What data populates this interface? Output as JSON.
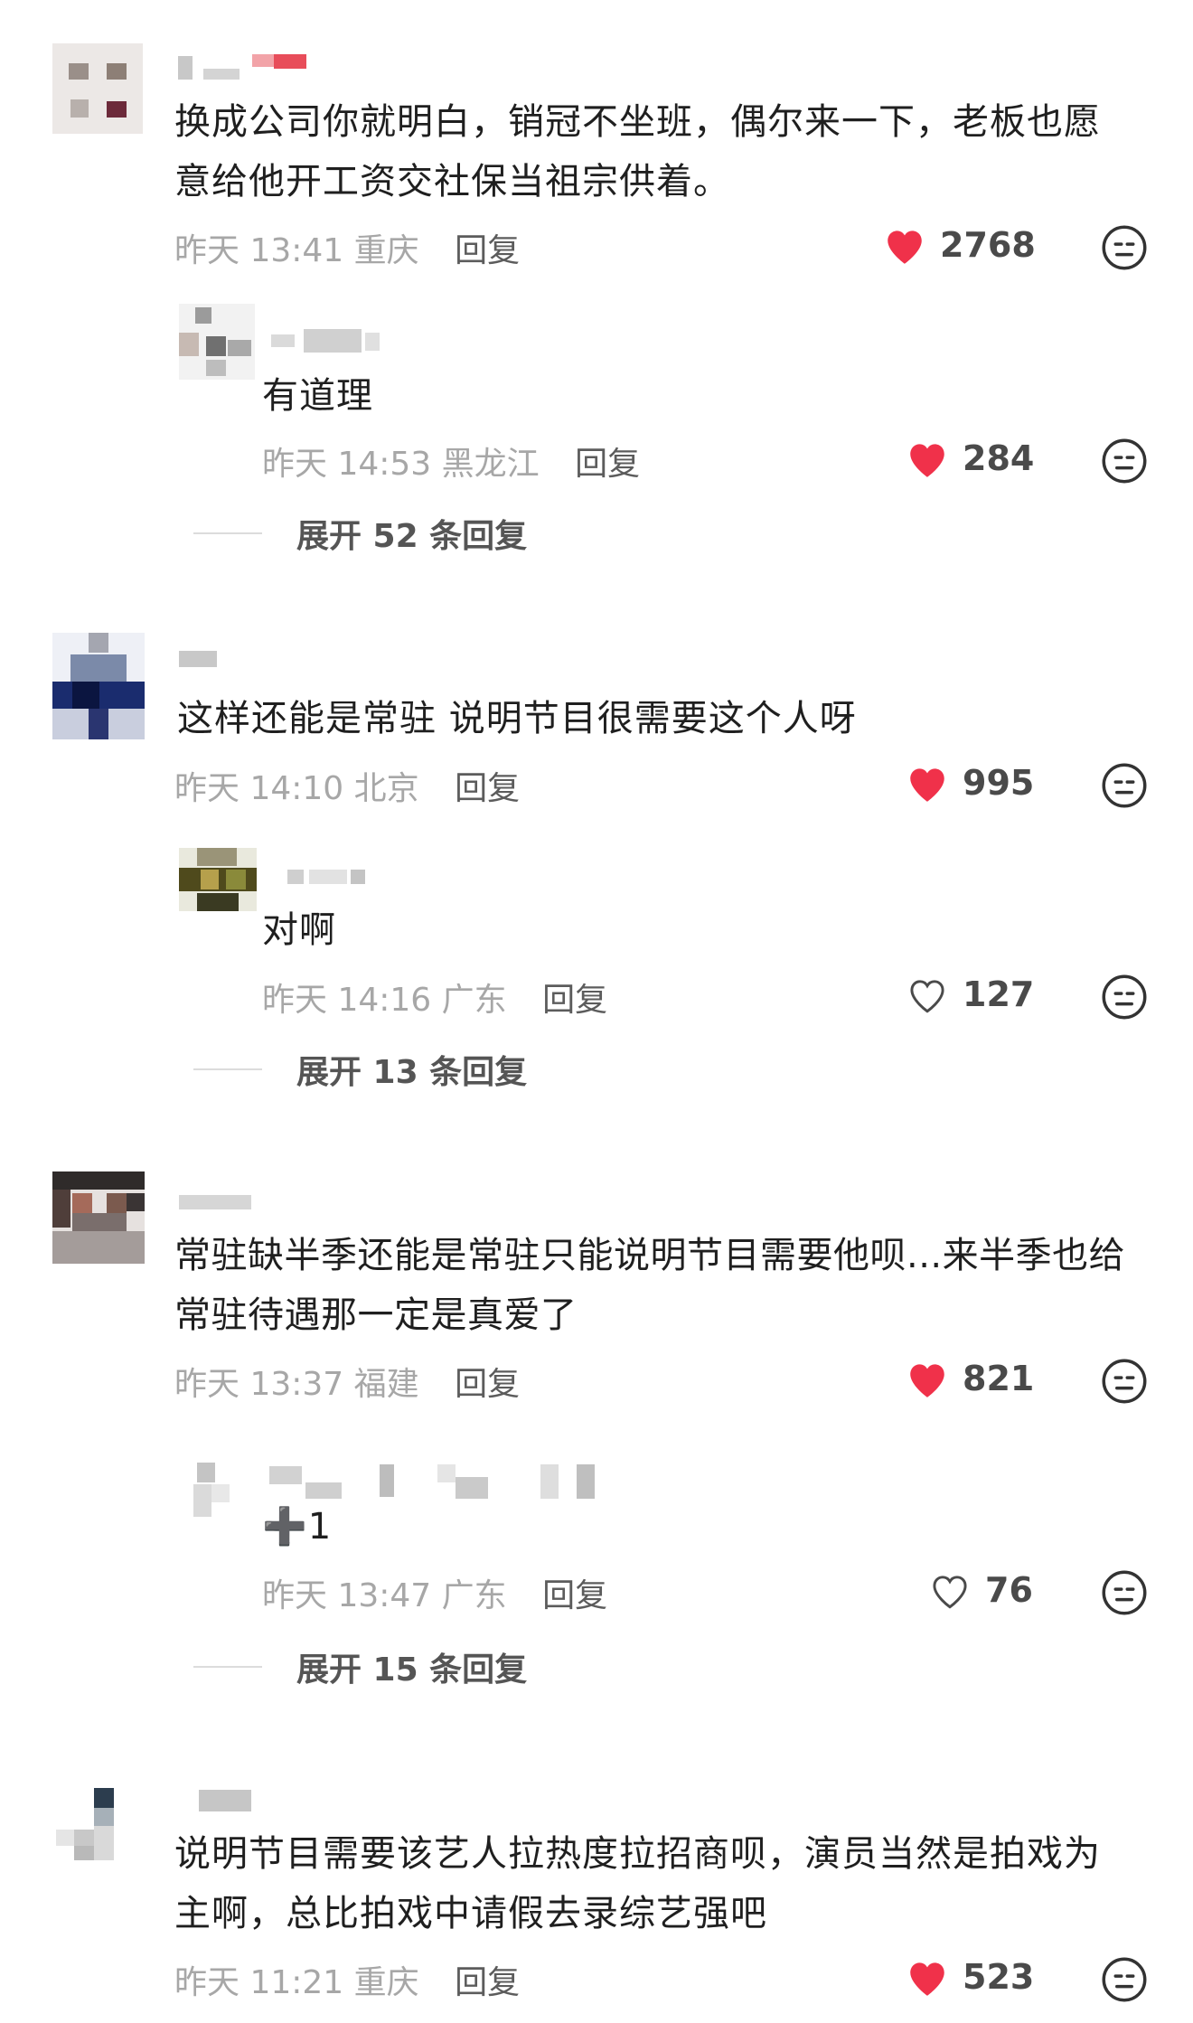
{
  "comments": [
    {
      "text": "换成公司你就明白，销冠不坐班，偶尔来一下，老板也愿意给他开工资交社保当祖宗供着。",
      "time": "昨天 13:41",
      "location": "重庆",
      "reply_label": "回复",
      "likes": "2768",
      "liked": true,
      "reply": {
        "text": "有道理",
        "time": "昨天 14:53",
        "location": "黑龙江",
        "reply_label": "回复",
        "likes": "284",
        "liked": true
      },
      "expand_label": "展开 52 条回复"
    },
    {
      "text": "这样还能是常驻 说明节目很需要这个人呀",
      "time": "昨天 14:10",
      "location": "北京",
      "reply_label": "回复",
      "likes": "995",
      "liked": true,
      "reply": {
        "text": "对啊",
        "time": "昨天 14:16",
        "location": "广东",
        "reply_label": "回复",
        "likes": "127",
        "liked": false
      },
      "expand_label": "展开 13 条回复"
    },
    {
      "text": "常驻缺半季还能是常驻只能说明节目需要他呗...来半季也给常驻待遇那一定是真爱了",
      "time": "昨天 13:37",
      "location": "福建",
      "reply_label": "回复",
      "likes": "821",
      "liked": true,
      "reply": {
        "text": "➕1",
        "time": "昨天 13:47",
        "location": "广东",
        "reply_label": "回复",
        "likes": "76",
        "liked": false
      },
      "expand_label": "展开 15 条回复"
    },
    {
      "text": "说明节目需要该艺人拉热度拉招商呗，演员当然是拍戏为主啊，总比拍戏中请假去录综艺强吧",
      "time": "昨天 11:21",
      "location": "重庆",
      "reply_label": "回复",
      "likes": "523",
      "liked": true
    }
  ],
  "colors": {
    "heart_red": "#f0314a",
    "meta_gray": "#a7a7a7",
    "text": "#1f1f1f"
  },
  "icons": [
    "heart-icon",
    "heart-outline-icon",
    "emoji-icon"
  ]
}
